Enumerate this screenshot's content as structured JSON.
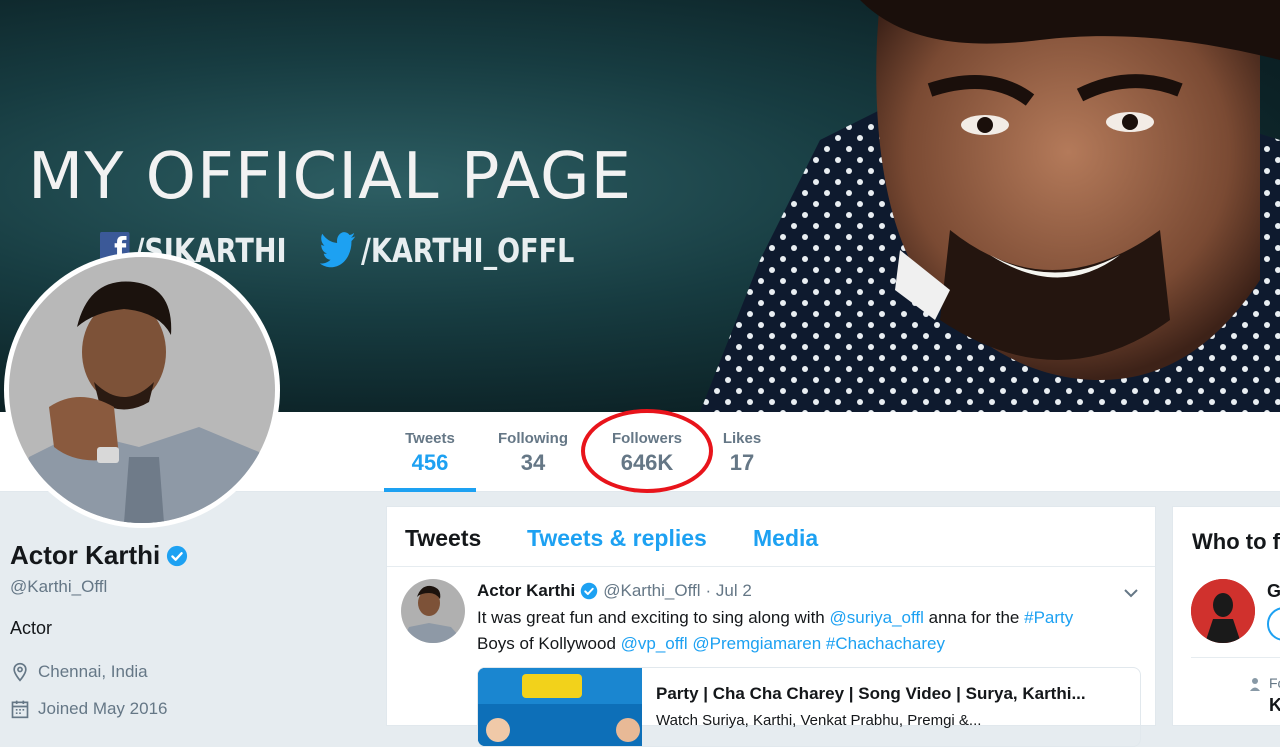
{
  "banner": {
    "title": "MY OFFICIAL PAGE",
    "facebook_handle": "/SIKARTHI",
    "twitter_handle": "/KARTHI_OFFL"
  },
  "nav": {
    "stats": [
      {
        "label": "Tweets",
        "value": "456"
      },
      {
        "label": "Following",
        "value": "34"
      },
      {
        "label": "Followers",
        "value": "646K"
      },
      {
        "label": "Likes",
        "value": "17"
      }
    ]
  },
  "profile": {
    "name": "Actor Karthi",
    "handle": "@Karthi_Offl",
    "bio": "Actor",
    "location": "Chennai, India",
    "joined": "Joined May 2016"
  },
  "timeline": {
    "tabs": [
      "Tweets",
      "Tweets & replies",
      "Media"
    ],
    "tweet": {
      "author": "Actor Karthi",
      "handle": "@Karthi_Offl",
      "date": "· Jul 2",
      "text_1": "It was great fun and exciting to sing along with ",
      "mention_1": "@suriya_offl",
      "text_2": " anna for the ",
      "hashtag_1": "#Party",
      "text_3": "Boys of Kollywood ",
      "mention_2": "@vp_offl",
      "mention_3": "@Premgiamaren",
      "hashtag_2": "#Chachacharey",
      "card_title": "Party | Cha Cha Charey | Song Video | Surya, Karthi...",
      "card_desc": "Watch Suriya, Karthi, Venkat Prabhu, Premgi &..."
    }
  },
  "who_to_follow": {
    "title": "Who to follow",
    "first_initial": "G",
    "small_text": "Fo",
    "second_initial": "K"
  },
  "colors": {
    "accent": "#1da1f2",
    "annotation": "#e8141b",
    "background": "#e6ecf0"
  }
}
